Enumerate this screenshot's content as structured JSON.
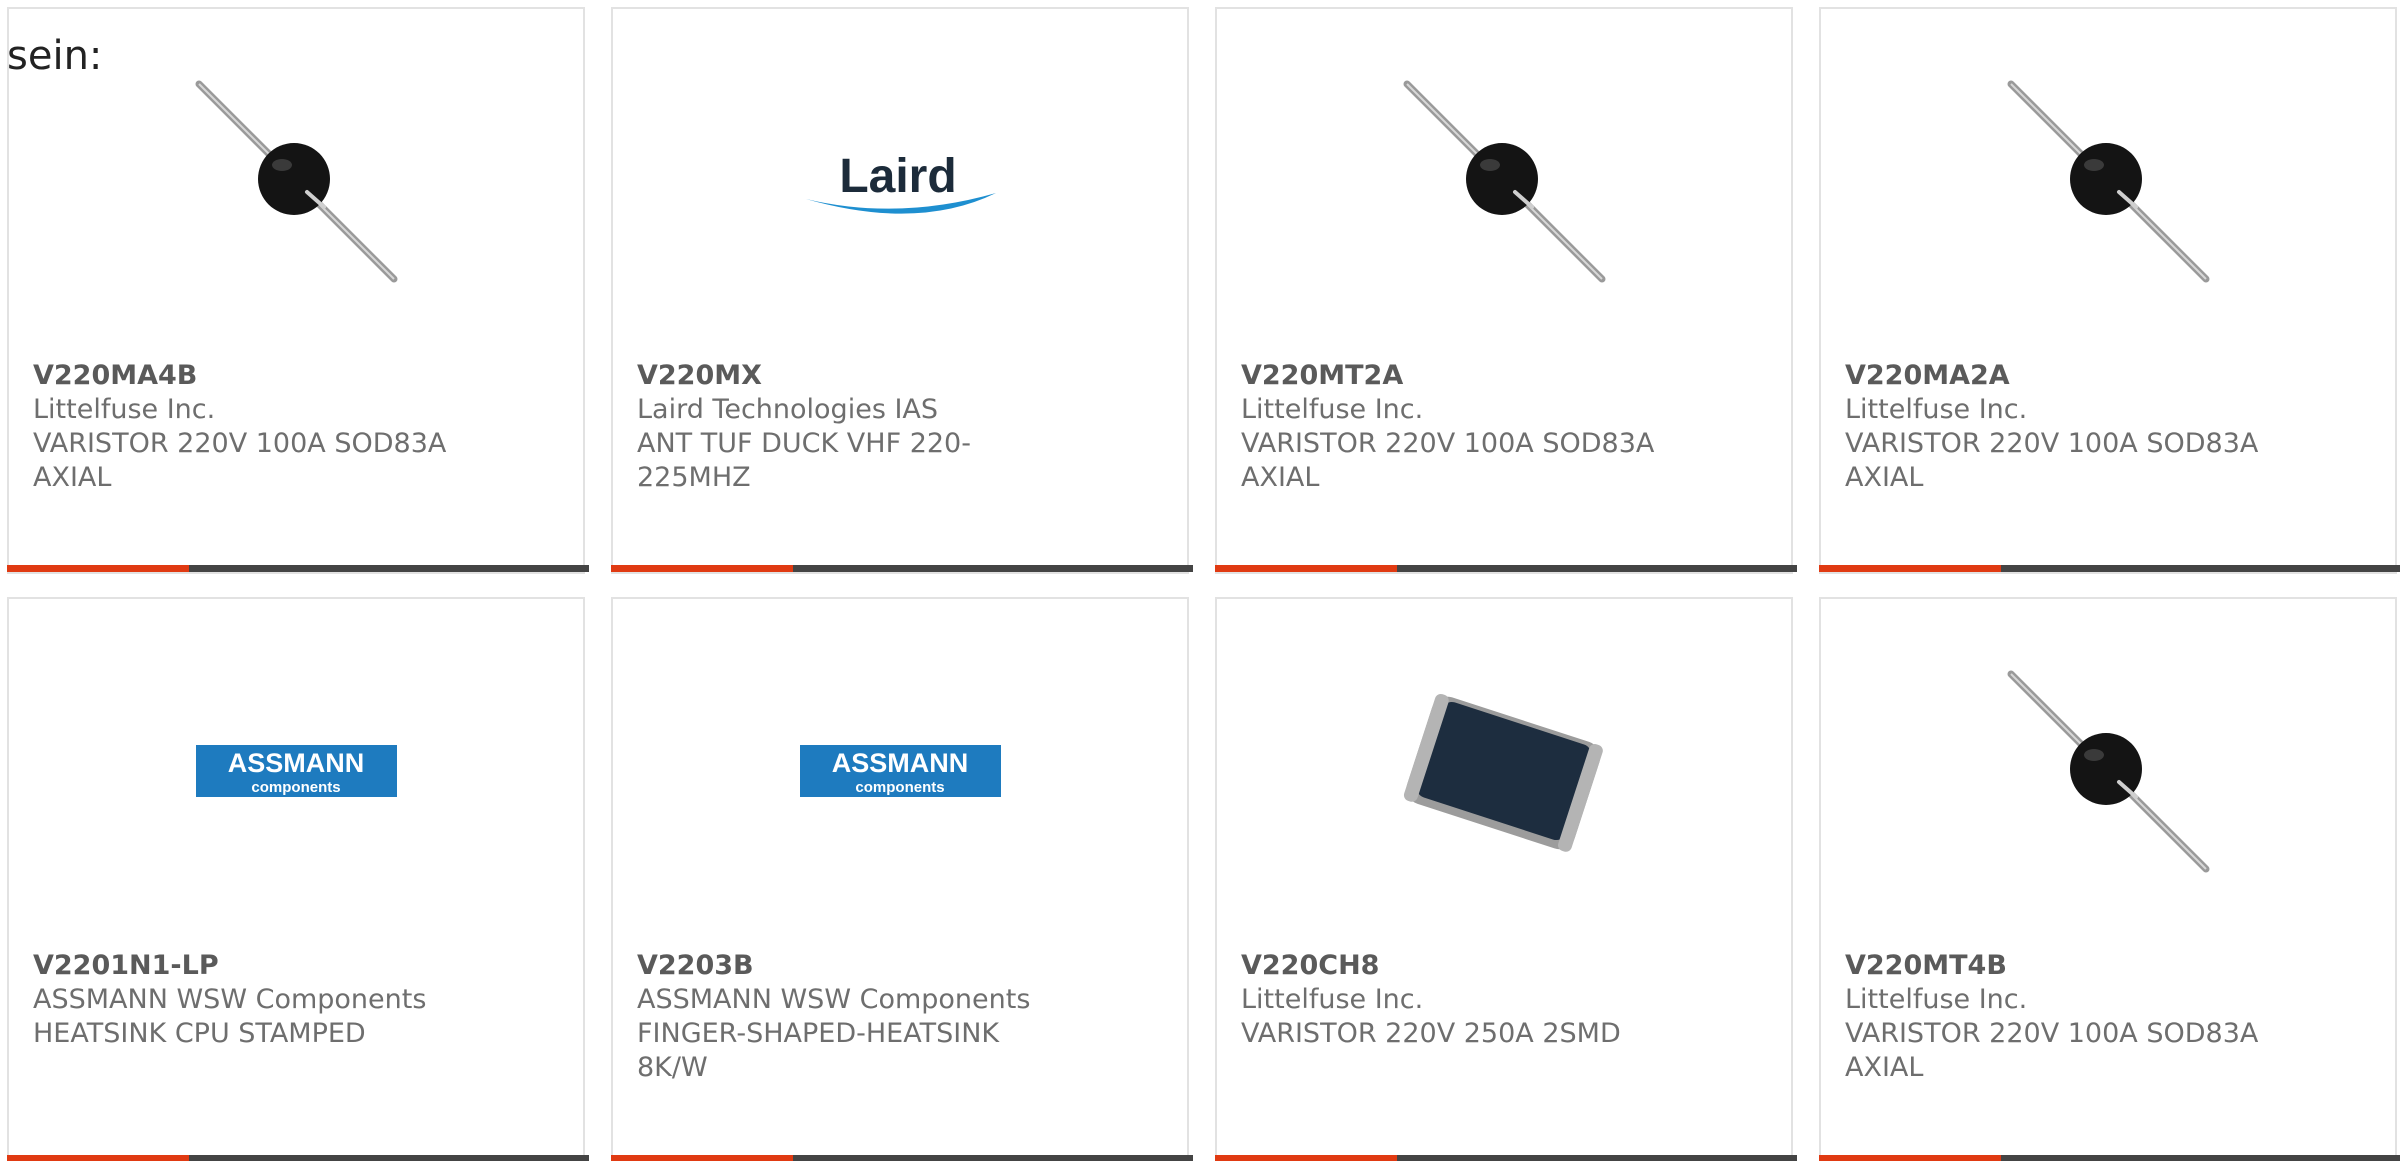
{
  "intro_text": "sein:",
  "colors": {
    "accent": "#e03a12",
    "bar": "#444444",
    "border": "#e2e2e2",
    "text": "#6e6e6e"
  },
  "products": [
    {
      "part_number": "V220MA4B",
      "manufacturer": "Littelfuse Inc.",
      "description": "VARISTOR 220V 100A SOD83A AXIAL",
      "image": "axial-varistor-icon"
    },
    {
      "part_number": "V220MX",
      "manufacturer": "Laird Technologies IAS",
      "description": "ANT TUF DUCK VHF 220-225MHZ",
      "image": "laird-logo",
      "logo_text": "Laird"
    },
    {
      "part_number": "V220MT2A",
      "manufacturer": "Littelfuse Inc.",
      "description": "VARISTOR 220V 100A SOD83A AXIAL",
      "image": "axial-varistor-icon"
    },
    {
      "part_number": "V220MA2A",
      "manufacturer": "Littelfuse Inc.",
      "description": "VARISTOR 220V 100A SOD83A AXIAL",
      "image": "axial-varistor-icon"
    },
    {
      "part_number": "V2201N1-LP",
      "manufacturer": "ASSMANN WSW Components",
      "description": "HEATSINK CPU STAMPED",
      "image": "assmann-logo",
      "logo_text": "ASSMANN",
      "logo_subtext": "components"
    },
    {
      "part_number": "V2203B",
      "manufacturer": "ASSMANN WSW Components",
      "description": "FINGER-SHAPED-HEATSINK 8K/W",
      "image": "assmann-logo",
      "logo_text": "ASSMANN",
      "logo_subtext": "components"
    },
    {
      "part_number": "V220CH8",
      "manufacturer": "Littelfuse Inc.",
      "description": "VARISTOR 220V 250A 2SMD",
      "image": "smd-varistor-icon"
    },
    {
      "part_number": "V220MT4B",
      "manufacturer": "Littelfuse Inc.",
      "description": "VARISTOR 220V 100A SOD83A AXIAL",
      "image": "axial-varistor-icon"
    }
  ]
}
